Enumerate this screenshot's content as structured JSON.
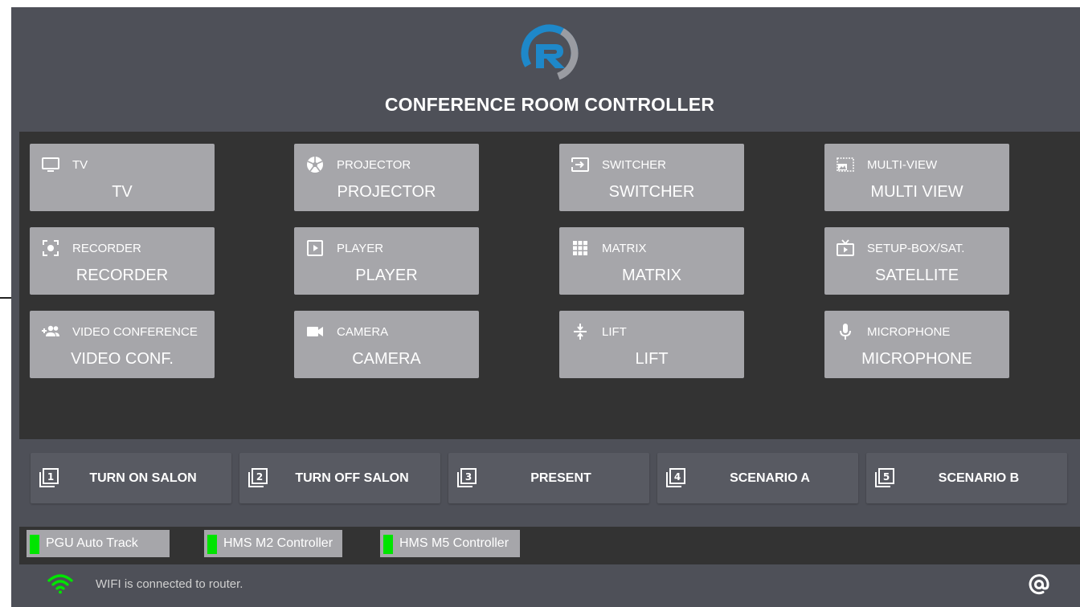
{
  "header": {
    "title": "CONFERENCE ROOM CONTROLLER"
  },
  "colors": {
    "accent_blue": "#1e88c9",
    "led_green": "#00e400",
    "wifi_green": "#00e400"
  },
  "devices": [
    {
      "icon": "tv-icon",
      "label": "TV",
      "name": "TV"
    },
    {
      "icon": "projector-icon",
      "label": "PROJECTOR",
      "name": "PROJECTOR"
    },
    {
      "icon": "switcher-icon",
      "label": "SWITCHER",
      "name": "SWITCHER"
    },
    {
      "icon": "multi-view-icon",
      "label": "MULTI-VIEW",
      "name": "MULTI VIEW"
    },
    {
      "icon": "recorder-icon",
      "label": "RECORDER",
      "name": "RECORDER"
    },
    {
      "icon": "player-icon",
      "label": "PLAYER",
      "name": "PLAYER"
    },
    {
      "icon": "matrix-icon",
      "label": "MATRIX",
      "name": "MATRIX"
    },
    {
      "icon": "satellite-tv-icon",
      "label": "SETUP-BOX/SAT.",
      "name": "SATELLITE"
    },
    {
      "icon": "group-add-icon",
      "label": "VIDEO CONFERENCE",
      "name": "VIDEO CONF."
    },
    {
      "icon": "camera-icon",
      "label": "CAMERA",
      "name": "CAMERA"
    },
    {
      "icon": "lift-icon",
      "label": "LIFT",
      "name": "LIFT"
    },
    {
      "icon": "microphone-icon",
      "label": "MICROPHONE",
      "name": "MICROPHONE"
    }
  ],
  "scenarios": [
    {
      "number": "1",
      "label": "TURN ON SALON"
    },
    {
      "number": "2",
      "label": "TURN OFF SALON"
    },
    {
      "number": "3",
      "label": "PRESENT"
    },
    {
      "number": "4",
      "label": "SCENARIO A"
    },
    {
      "number": "5",
      "label": "SCENARIO B"
    }
  ],
  "controllers": [
    {
      "label": "PGU Auto Track",
      "connected": true
    },
    {
      "label": "HMS M2 Controller",
      "connected": true
    },
    {
      "label": "HMS M5 Controller",
      "connected": true
    }
  ],
  "footer": {
    "wifi_status": "WIFI is connected to router."
  }
}
